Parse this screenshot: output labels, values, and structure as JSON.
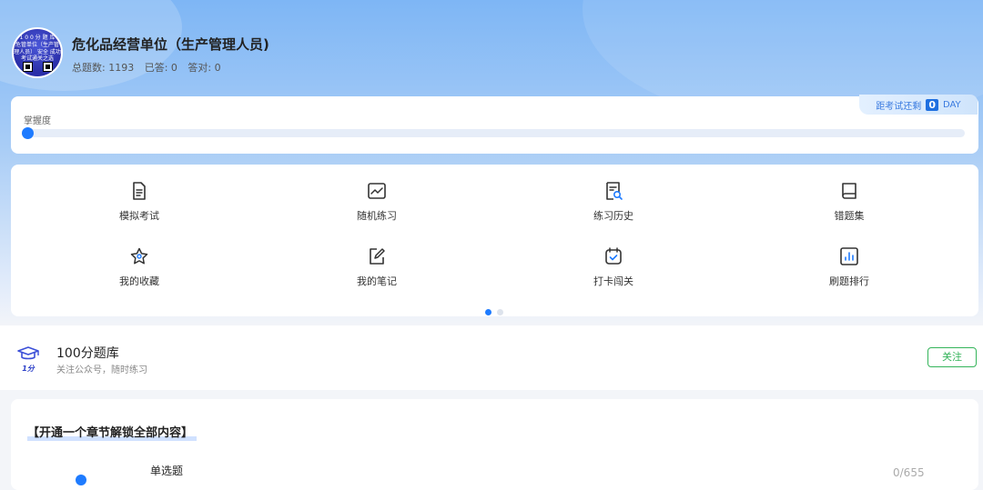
{
  "header": {
    "title": "危化品经营单位（生产管理人员)",
    "total_label": "总题数: 1193",
    "answered_label": "已答: 0",
    "correct_label": "答对: 0",
    "avatar_lines": [
      "1 0 0 分 题 库",
      "危管单位（生产管",
      "理人员）  安全  成功",
      "考试通关之选"
    ]
  },
  "mastery": {
    "label": "掌握度",
    "progress": 0
  },
  "countdown": {
    "prefix": "距考试还剩",
    "days": "0",
    "unit": "DAY"
  },
  "menu": {
    "items": [
      {
        "label": "模拟考试",
        "icon": "document-icon"
      },
      {
        "label": "随机练习",
        "icon": "line-chart-icon"
      },
      {
        "label": "练习历史",
        "icon": "history-search-icon"
      },
      {
        "label": "错题集",
        "icon": "book-icon"
      },
      {
        "label": "我的收藏",
        "icon": "star-icon"
      },
      {
        "label": "我的笔记",
        "icon": "edit-note-icon"
      },
      {
        "label": "打卡闯关",
        "icon": "calendar-check-icon"
      },
      {
        "label": "刷题排行",
        "icon": "bar-chart-icon"
      }
    ],
    "pages": 2,
    "active_page": 1
  },
  "follow": {
    "name": "100分题库",
    "desc": "关注公众号，随时练习",
    "button": "关注",
    "logo_text": "1分"
  },
  "chapter": {
    "title": "【开通一个章节解锁全部内容】",
    "question_type": "单选题",
    "count": "0/655"
  },
  "colors": {
    "accent": "#1e7bff",
    "follow_green": "#34b45a"
  }
}
